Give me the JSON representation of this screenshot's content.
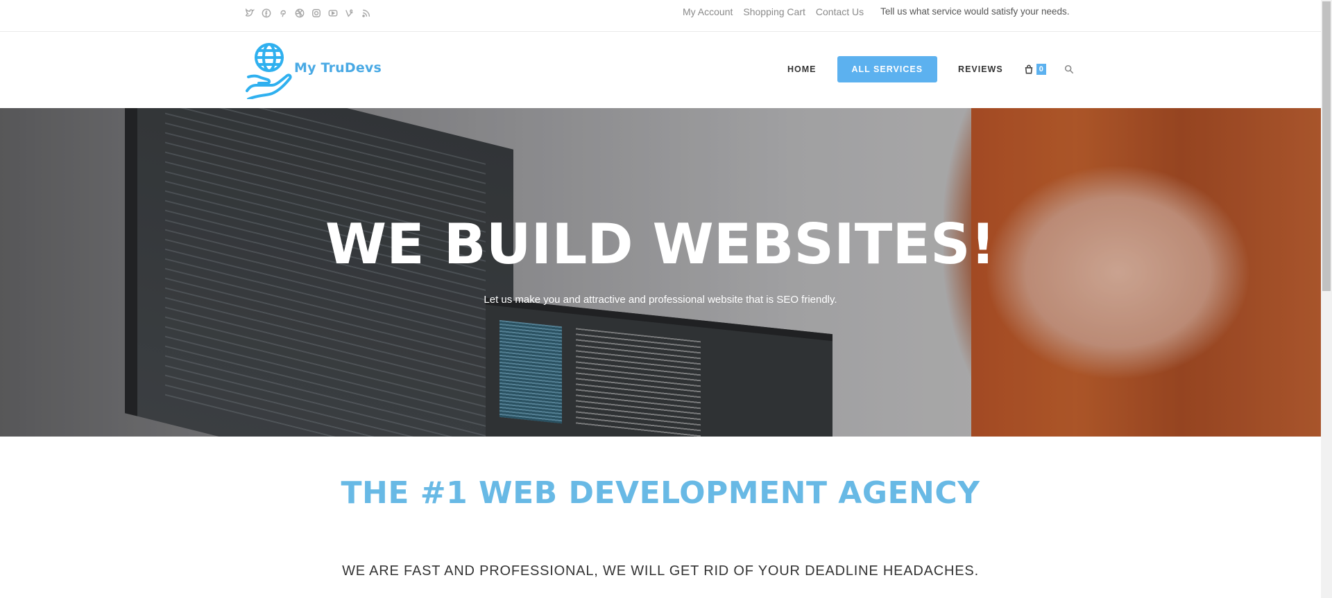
{
  "topbar": {
    "social_icons": [
      "twitter-icon",
      "facebook-icon",
      "pinterest-icon",
      "dribbble-icon",
      "instagram-icon",
      "youtube-icon",
      "vine-icon",
      "rss-icon"
    ],
    "links": [
      "My Account",
      "Shopping Cart",
      "Contact Us"
    ],
    "tagline": "Tell us what service would satisfy your needs."
  },
  "header": {
    "logo_text": "My TruDevs",
    "nav": [
      "HOME",
      "ALL SERVICES",
      "REVIEWS"
    ],
    "active_nav": "ALL SERVICES",
    "cart_count": "0"
  },
  "hero": {
    "title": "WE BUILD WEBSITES!",
    "subtitle": "Let us make you and attractive and professional website that is SEO friendly."
  },
  "content": {
    "headline": "THE #1 WEB DEVELOPMENT AGENCY",
    "tagline": "WE ARE FAST AND PROFESSIONAL, WE WILL GET RID OF YOUR DEADLINE HEADACHES."
  },
  "colors": {
    "accent": "#5cb1ef",
    "headline": "#68b9e5"
  }
}
